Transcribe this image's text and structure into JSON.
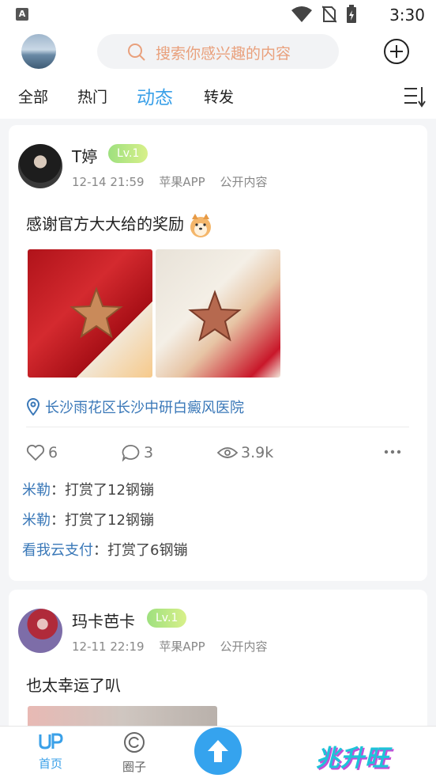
{
  "status_bar": {
    "time": "3:30",
    "left_badge": "A"
  },
  "search": {
    "placeholder": "搜索你感兴趣的内容"
  },
  "tabs": [
    {
      "label": "全部"
    },
    {
      "label": "热门"
    },
    {
      "label": "动态",
      "active": true
    },
    {
      "label": "转发"
    }
  ],
  "posts": [
    {
      "username": "T婷",
      "level": "Lv.1",
      "time": "12-14 21:59",
      "source": "苹果APP",
      "visibility": "公开内容",
      "text": "感谢官方大大给的奖励",
      "location": "长沙雨花区长沙中研白癜风医院",
      "likes": "6",
      "comments": "3",
      "views": "3.9k",
      "rewards": [
        {
          "user": "米勒",
          "sep": "：",
          "action": "打赏了12钢镚"
        },
        {
          "user": "米勒",
          "sep": "：",
          "action": "打赏了12钢镚"
        },
        {
          "user": "看我云支付",
          "sep": "：",
          "action": "打赏了6钢镚"
        }
      ]
    },
    {
      "username": "玛卡芭卡",
      "level": "Lv.1",
      "time": "12-11 22:19",
      "source": "苹果APP",
      "visibility": "公开内容",
      "text": "也太幸运了叭"
    }
  ],
  "bottom_nav": [
    {
      "label": "首页",
      "icon": "home-logo-icon",
      "active": true
    },
    {
      "label": "圈子",
      "icon": "circle-icon"
    }
  ],
  "watermark": "兆升旺",
  "colors": {
    "accent": "#3aa0e8",
    "link": "#3a78b8",
    "level_badge": "#9ee07f",
    "search_text": "#e9a07c"
  }
}
